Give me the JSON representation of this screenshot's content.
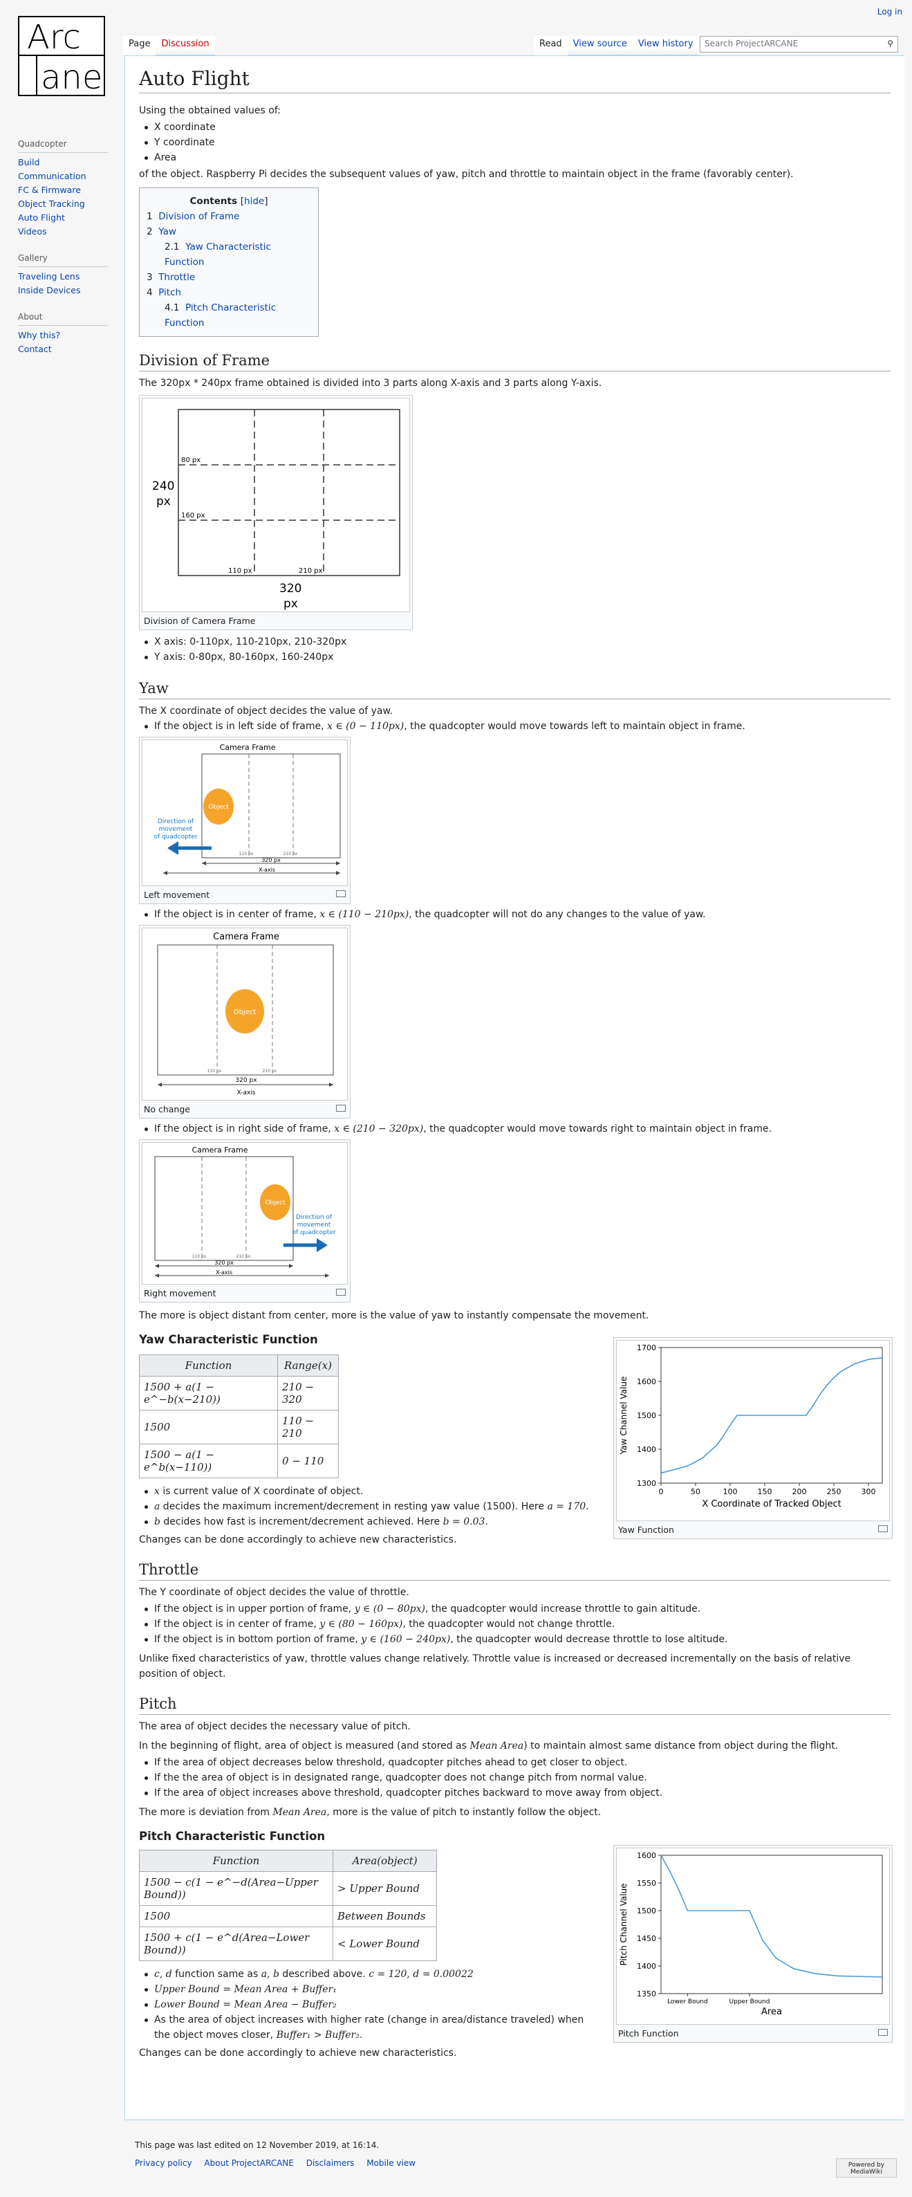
{
  "header": {
    "login": "Log in",
    "tabs_left": [
      "Page",
      "Discussion"
    ],
    "tabs_right": [
      "Read",
      "View source",
      "View history"
    ],
    "search_placeholder": "Search ProjectARCANE",
    "logo_top": "Arc",
    "logo_bottom": "ane"
  },
  "sidebar": {
    "sections": [
      {
        "heading": "Quadcopter",
        "items": [
          "Build",
          "Communication",
          "FC & Firmware",
          "Object Tracking",
          "Auto Flight",
          "Videos"
        ]
      },
      {
        "heading": "Gallery",
        "items": [
          "Traveling Lens",
          "Inside Devices"
        ]
      },
      {
        "heading": "About",
        "items": [
          "Why this?",
          "Contact"
        ]
      }
    ]
  },
  "page": {
    "title": "Auto Flight",
    "intro": "Using the obtained values of:",
    "intro_items": [
      "X coordinate",
      "Y coordinate",
      "Area"
    ],
    "intro_tail": "of the object. Raspberry Pi decides the subsequent values of yaw, pitch and throttle to maintain object in the frame (favorably center)."
  },
  "toc": {
    "title": "Contents",
    "hide": "hide",
    "items": [
      {
        "num": "1",
        "text": "Division of Frame",
        "lvl": 1
      },
      {
        "num": "2",
        "text": "Yaw",
        "lvl": 1
      },
      {
        "num": "2.1",
        "text": "Yaw Characteristic Function",
        "lvl": 2
      },
      {
        "num": "3",
        "text": "Throttle",
        "lvl": 1
      },
      {
        "num": "4",
        "text": "Pitch",
        "lvl": 1
      },
      {
        "num": "4.1",
        "text": "Pitch Characteristic Function",
        "lvl": 2
      }
    ]
  },
  "division": {
    "heading": "Division of Frame",
    "text": "The 320px * 240px frame obtained is divided into 3 parts along X-axis and 3 parts along Y-axis.",
    "fig_label_h": "240",
    "fig_label_h2": "px",
    "fig_label_w": "320",
    "fig_label_w2": "px",
    "l80": "80 px",
    "l160": "160 px",
    "l110": "110 px",
    "l210": "210 px",
    "caption": "Division of Camera Frame",
    "items": [
      "X axis: 0-110px, 110-210px, 210-320px",
      "Y axis: 0-80px, 80-160px, 160-240px"
    ]
  },
  "yaw": {
    "heading": "Yaw",
    "text": "The X coordinate of object decides the value of yaw.",
    "b1": "If the object is in left side of frame, ",
    "b1m": "x ∈ (0 − 110px)",
    "b1t": ", the quadcopter would move towards left to maintain object in frame.",
    "b2": "If the object is in center of frame, ",
    "b2m": "x ∈ (110 − 210px)",
    "b2t": ", the quadcopter will not do any changes to the value of yaw.",
    "b3": "If the object is in right side of frame, ",
    "b3m": "x ∈ (210 − 320px)",
    "b3t": ", the quadcopter would move towards right to maintain object in frame.",
    "cam_title": "Camera Frame",
    "object": "Object",
    "dir1": "Direction of",
    "dir2": "movement",
    "dir3": "of quadcopter",
    "w320": "320 px",
    "xaxis": "X-axis",
    "t110": "110 px",
    "t210": "210 px",
    "cap1": "Left movement",
    "cap2": "No change",
    "cap3": "Right movement",
    "after": "The more is object distant from center, more is the value of yaw to instantly compensate the movement."
  },
  "yawfn": {
    "heading": "Yaw Characteristic Function",
    "th1": "Function",
    "th2": "Range(x)",
    "rows": [
      [
        "1500 + a(1 − e^−b(x−210))",
        "210 − 320"
      ],
      [
        "1500",
        "110 − 210"
      ],
      [
        "1500 − a(1 − e^b(x−110))",
        "0 − 110"
      ]
    ],
    "n1m": "x",
    "n1": " is current value of X coordinate of object.",
    "n2m": "a",
    "n2": " decides the maximum increment/decrement in resting yaw value (1500). Here ",
    "n2v": "a = 170.",
    "n3m": "b",
    "n3": " decides how fast is increment/decrement achieved. Here ",
    "n3v": "b = 0.03.",
    "after": "Changes can be done accordingly to achieve new characteristics.",
    "caption": "Yaw Function"
  },
  "throttle": {
    "heading": "Throttle",
    "text": "The Y coordinate of object decides the value of throttle.",
    "b1": "If the object is in upper portion of frame, ",
    "b1m": "y ∈ (0 − 80px)",
    "b1t": ", the quadcopter would increase throttle to gain altitude.",
    "b2": "If the object is in center of frame, ",
    "b2m": "y ∈ (80 − 160px)",
    "b2t": ", the quadcopter would not change throttle.",
    "b3": "If the object is in bottom portion of frame, ",
    "b3m": "y ∈ (160 − 240px)",
    "b3t": ", the quadcopter would decrease throttle to lose altitude.",
    "after": "Unlike fixed characteristics of yaw, throttle values change relatively. Throttle value is increased or decreased incrementally on the basis of relative position of object."
  },
  "pitch": {
    "heading": "Pitch",
    "text": "The area of object decides the necessary value of pitch.",
    "t2a": "In the beginning of flight, area of object is measured (and stored as ",
    "t2m": "Mean Area",
    "t2b": ") to maintain almost same distance from object during the flight.",
    "items": [
      "If the area of object decreases below threshold, quadcopter pitches ahead to get closer to object.",
      "If the the area of object is in designated range, quadcopter does not change pitch from normal value.",
      "If the area of object increases above threshold, quadcopter pitches backward to move away from object."
    ],
    "after_a": "The more is deviation from ",
    "after_m": "Mean Area",
    "after_b": ", more is the value of pitch to instantly follow the object."
  },
  "pitchfn": {
    "heading": "Pitch Characteristic Function",
    "th1": "Function",
    "th2": "Area(object)",
    "rows": [
      [
        "1500 − c(1 − e^−d(Area−Upper Bound))",
        "> Upper Bound"
      ],
      [
        "1500",
        "Between Bounds"
      ],
      [
        "1500 + c(1 − e^d(Area−Lower Bound))",
        "< Lower Bound"
      ]
    ],
    "n1m": "c, d",
    "n1": " function same as ",
    "n1m2": "a, b",
    "n1b": " described above. ",
    "n1v": "c = 120, d = 0.00022",
    "n2": "Upper Bound = Mean Area + Buffer₁",
    "n3": "Lower Bound = Mean Area − Buffer₂",
    "n4a": "As the area of object increases with higher rate (change in area/distance traveled) when the object moves closer, ",
    "n4m": "Buffer₁ > Buffer₂",
    "n4b": ".",
    "after": "Changes can be done accordingly to achieve new characteristics.",
    "caption": "Pitch Function"
  },
  "footer": {
    "edited": "This page was last edited on 12 November 2019, at 16:14.",
    "links": [
      "Privacy policy",
      "About ProjectARCANE",
      "Disclaimers",
      "Mobile view"
    ],
    "badge": "Powered by MediaWiki"
  },
  "chart_data": [
    {
      "type": "line",
      "title": "",
      "xlabel": "X Coordinate of Tracked Object",
      "ylabel": "Yaw Channel Value",
      "xlim": [
        0,
        320
      ],
      "ylim": [
        1300,
        1700
      ],
      "xticks": [
        0,
        50,
        100,
        150,
        200,
        250,
        300
      ],
      "yticks": [
        1300,
        1400,
        1500,
        1600,
        1700
      ],
      "color": "#4a9ad8",
      "x": [
        0,
        20,
        40,
        60,
        80,
        90,
        100,
        110,
        150,
        210,
        220,
        230,
        240,
        250,
        260,
        280,
        300,
        320
      ],
      "y": [
        1330,
        1340,
        1352,
        1374,
        1411,
        1438,
        1471,
        1500,
        1500,
        1500,
        1529,
        1562,
        1589,
        1611,
        1629,
        1652,
        1665,
        1670
      ]
    },
    {
      "type": "line",
      "title": "",
      "xlabel": "Area",
      "ylabel": "Pitch Channel Value",
      "ylim": [
        1350,
        1600
      ],
      "xtick_labels": [
        "Lower Bound",
        "Upper Bound"
      ],
      "yticks": [
        1350,
        1400,
        1450,
        1500,
        1550,
        1600
      ],
      "color": "#4a9ad8",
      "x": [
        0,
        0.04,
        0.08,
        0.12,
        0.3,
        0.4,
        0.46,
        0.52,
        0.6,
        0.7,
        0.8,
        1.0
      ],
      "y": [
        1600,
        1571,
        1538,
        1500,
        1500,
        1500,
        1446,
        1414,
        1395,
        1386,
        1382,
        1380
      ]
    }
  ]
}
